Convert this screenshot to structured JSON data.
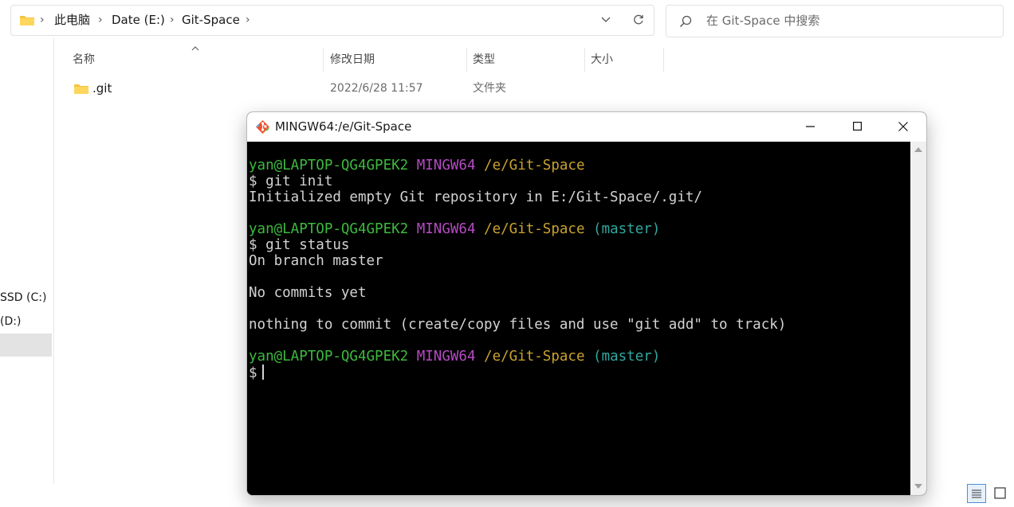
{
  "explorer": {
    "breadcrumb": [
      "此电脑",
      "Date (E:)",
      "Git-Space"
    ],
    "search_placeholder": "在 Git-Space 中搜索",
    "columns": [
      "名称",
      "修改日期",
      "类型",
      "大小"
    ],
    "files": [
      {
        "name": ".git",
        "modified": "2022/6/28 11:57",
        "type": "文件夹",
        "size": ""
      }
    ],
    "sidebar": {
      "drives": [
        "SSD (C:)",
        "(D:)"
      ]
    }
  },
  "terminal": {
    "title": "MINGW64:/e/Git-Space",
    "lines": [
      {
        "user_host": "yan@LAPTOP-QG4GPEK2",
        "system": "MINGW64",
        "path": "/e/Git-Space",
        "branch": ""
      },
      {
        "text": "$ git init"
      },
      {
        "text": "Initialized empty Git repository in E:/Git-Space/.git/"
      },
      {
        "user_host": "yan@LAPTOP-QG4GPEK2",
        "system": "MINGW64",
        "path": "/e/Git-Space",
        "branch": "(master)"
      },
      {
        "text": "$ git status"
      },
      {
        "text": "On branch master"
      },
      {
        "text": "No commits yet"
      },
      {
        "text": "nothing to commit (create/copy files and use \"git add\" to track)"
      },
      {
        "user_host": "yan@LAPTOP-QG4GPEK2",
        "system": "MINGW64",
        "path": "/e/Git-Space",
        "branch": "(master)"
      },
      {
        "text": "$"
      }
    ],
    "colors": {
      "user_host": "#3dba3d",
      "system": "#b64ac4",
      "path": "#c9a22f",
      "branch": "#31a8a0",
      "text": "#d3d3d3",
      "background": "#000000"
    }
  }
}
